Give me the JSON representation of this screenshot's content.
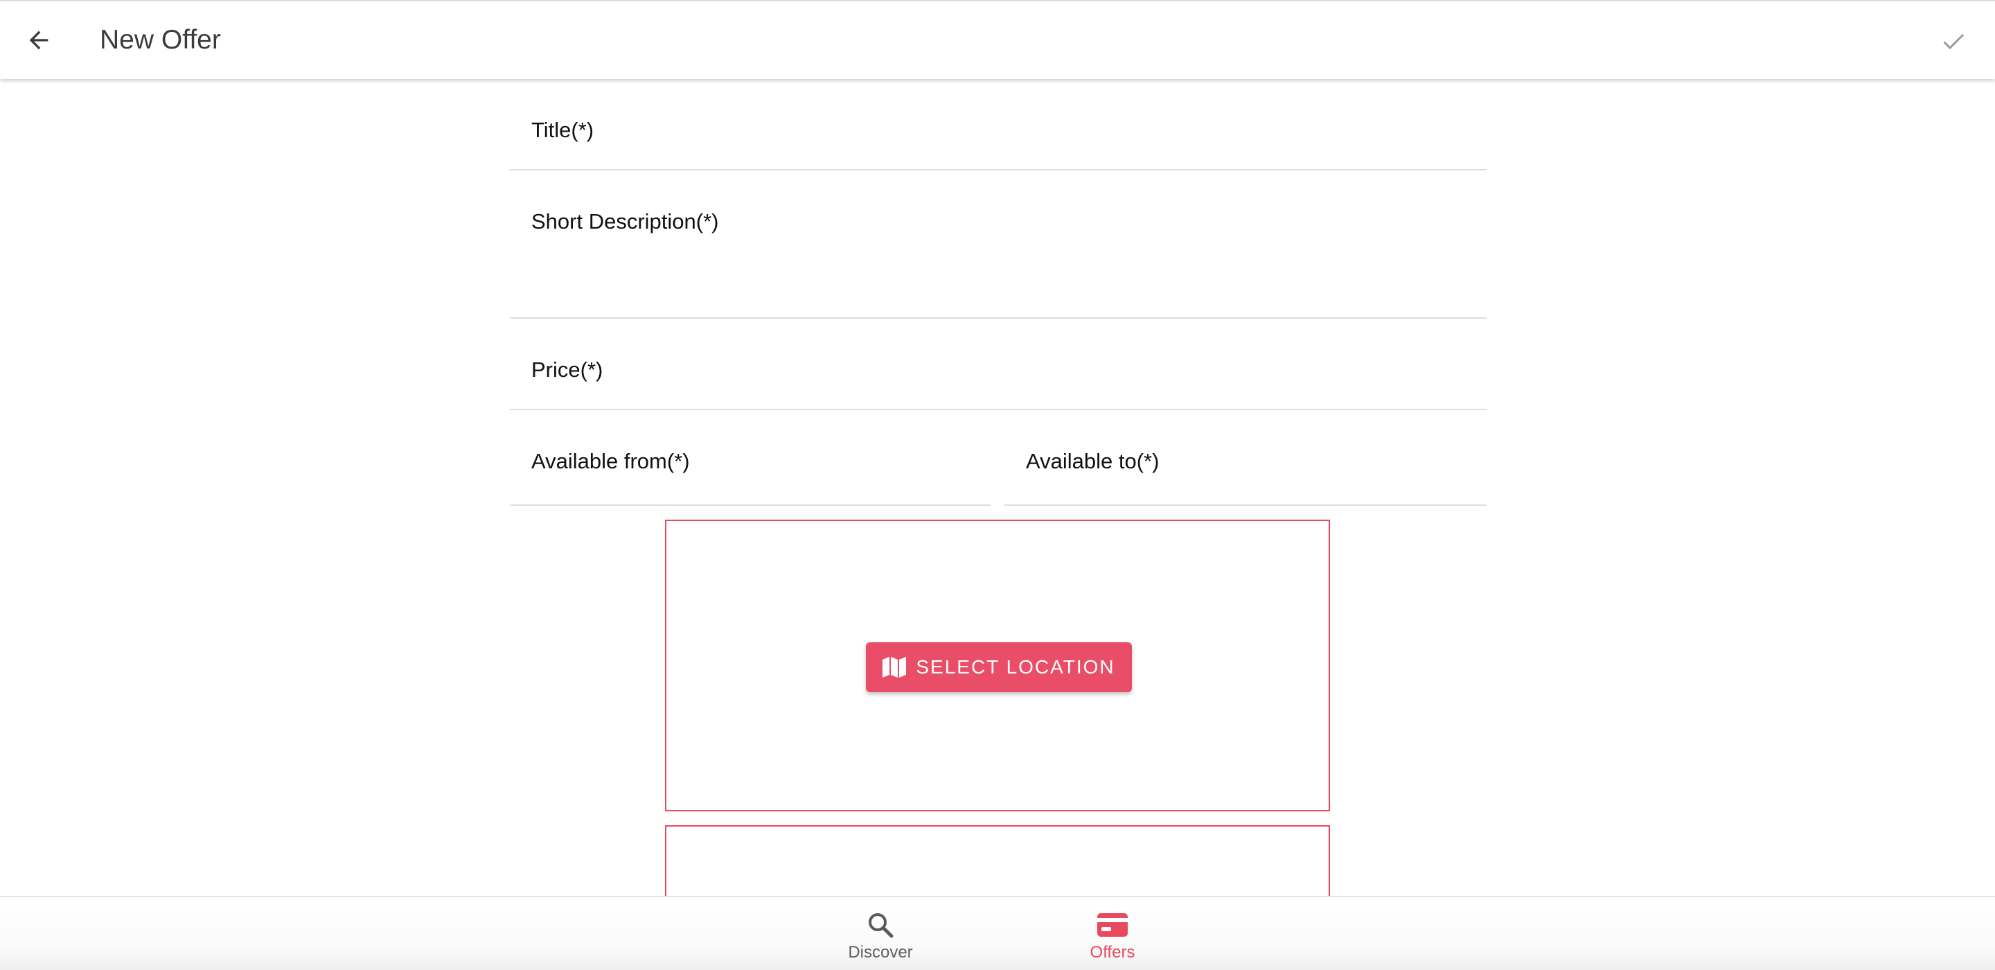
{
  "header": {
    "title": "New Offer",
    "back_icon": "arrow-back-icon",
    "confirm_icon": "checkmark-icon"
  },
  "form": {
    "title_label": "Title(*)",
    "description_label": "Short Description(*)",
    "price_label": "Price(*)",
    "available_from_label": "Available from(*)",
    "available_to_label": "Available to(*)"
  },
  "location": {
    "button_label": "SELECT LOCATION",
    "button_icon": "map-icon"
  },
  "tabs": [
    {
      "label": "Discover",
      "icon": "search-icon",
      "active": false
    },
    {
      "label": "Offers",
      "icon": "card-icon",
      "active": true
    }
  ],
  "colors": {
    "accent": "#e8495f",
    "button": "#ea4d68",
    "header_text": "#3c3c3c",
    "inactive_tab": "#5f5f5f"
  }
}
